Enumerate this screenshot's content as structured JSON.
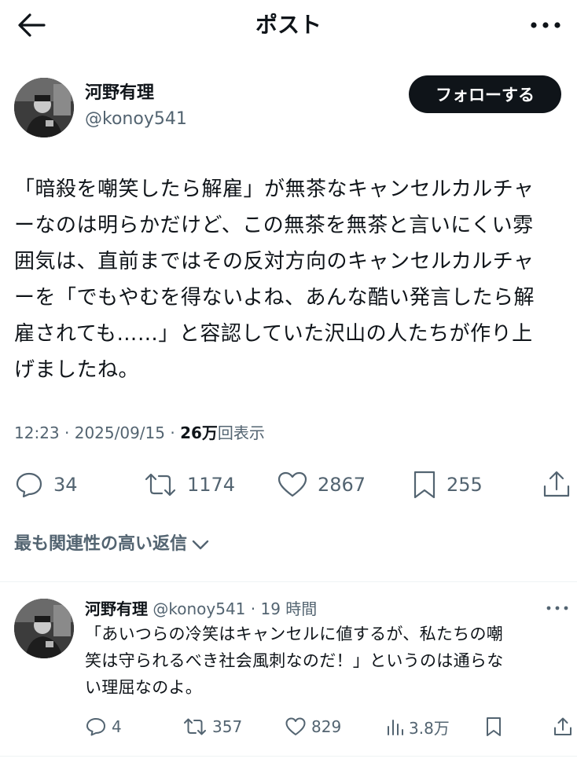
{
  "header": {
    "title": "ポスト"
  },
  "author": {
    "name": "河野有理",
    "handle": "@konoy541",
    "follow_label": "フォローする"
  },
  "post": {
    "text": "「暗殺を嘲笑したら解雇」が無茶なキャンセルカルチャ\nーなのは明らかだけど、この無茶を無茶と言いにくい雰\n囲気は、直前まではその反対方向のキャンセルカルチャ\nーを「でもやむを得ないよね、あんな酷い発言したら解\n雇されても……」と容認していた沢山の人たちが作り上\nげましたね。",
    "time": "12:23",
    "sep1": " · ",
    "date": "2025/09/15",
    "sep2": " · ",
    "views": "26万",
    "views_label": "回表示",
    "stats": {
      "replies": "34",
      "reposts": "1174",
      "likes": "2867",
      "bookmarks": "255"
    }
  },
  "sort_label": "最も関連性の高い返信",
  "reply": {
    "name": "河野有理",
    "handle": "@konoy541",
    "sep": " · ",
    "time": "19 時間",
    "text": "「あいつらの冷笑はキャンセルに値するが、私たちの嘲\n笑は守られるべき社会風刺なのだ！」というのは通らな\nい理屈なのよ。",
    "stats": {
      "replies": "4",
      "reposts": "357",
      "likes": "829",
      "views": "3.8万"
    }
  }
}
